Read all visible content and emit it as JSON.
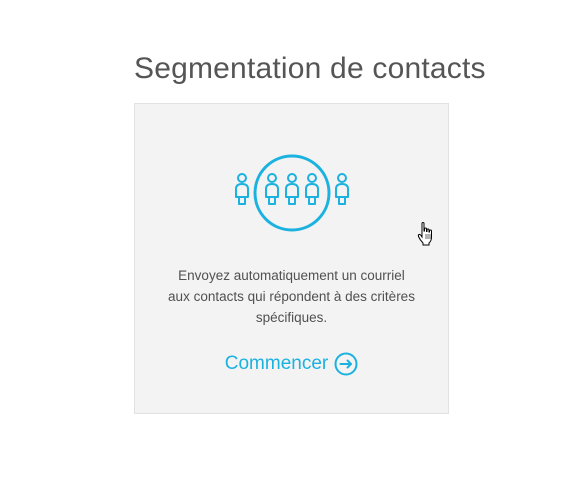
{
  "page": {
    "title": "Segmentation de contacts"
  },
  "card": {
    "icon": "people-group-icon",
    "description_lines": [
      "Envoyez automatiquement un courriel",
      "aux contacts qui répondent à des critères",
      "spécifiques."
    ],
    "cta_label": "Commencer",
    "cta_icon": "arrow-right-circle-icon"
  },
  "colors": {
    "accent": "#1bb2e0",
    "card_background": "#f3f3f3",
    "title_text": "#555555",
    "body_text": "#505050"
  }
}
